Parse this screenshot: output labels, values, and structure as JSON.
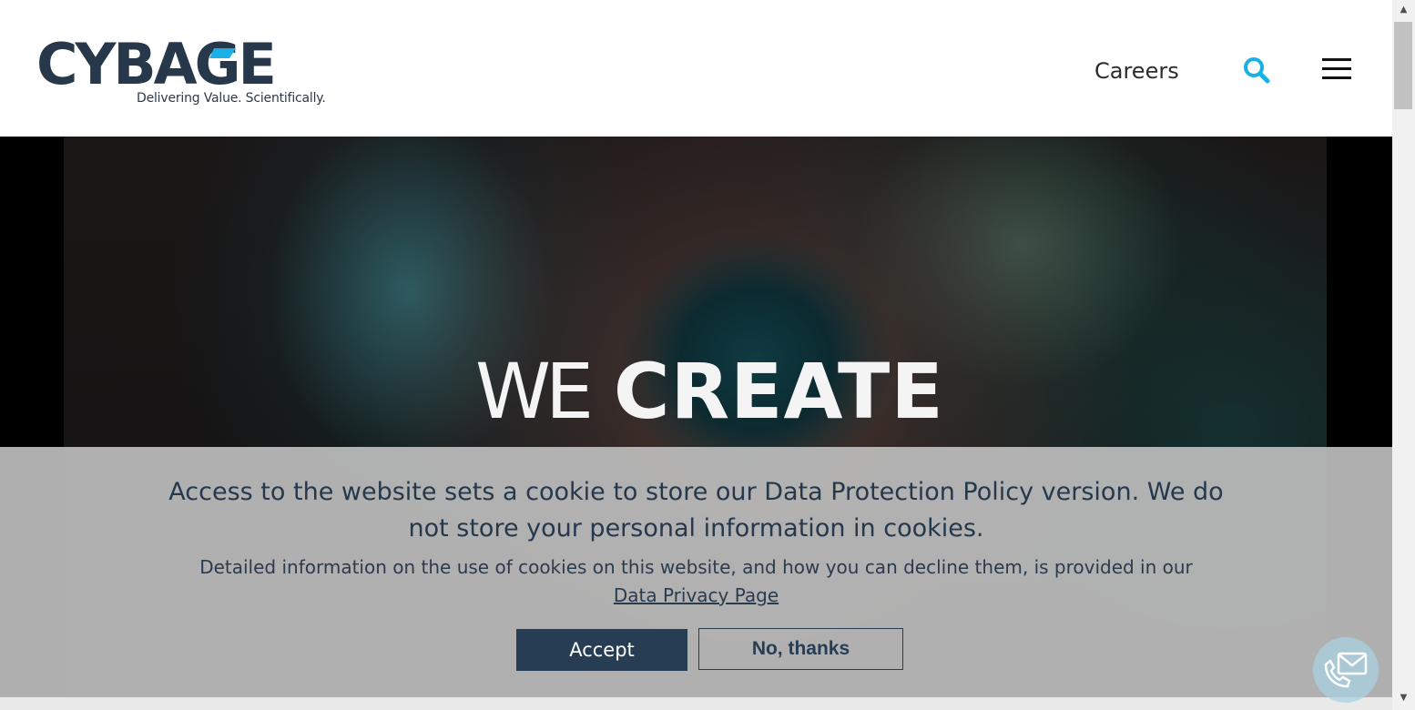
{
  "header": {
    "logo_text": "CYBAGE",
    "tagline": "Delivering Value. Scientifically.",
    "nav_careers": "Careers",
    "search_icon": "search-icon",
    "menu_icon": "hamburger-menu-icon",
    "accent_color": "#1ab0e6"
  },
  "hero": {
    "headline_light": "WE",
    "headline_bold": "CREATE"
  },
  "cookie_banner": {
    "heading": "Access to the website sets a cookie to store our Data Protection Policy version. We do not store your personal information in cookies.",
    "detail": "Detailed information on the use of cookies on this website, and how you can decline them, is provided in our",
    "link_label": "Data Privacy Page",
    "accept_label": "Accept",
    "decline_label": "No, thanks",
    "text_color": "#25384c",
    "button_color": "#263d54"
  },
  "contact_fab": {
    "icon": "contact-phone-mail-icon"
  },
  "scrollbar": {
    "up_arrow": "▲",
    "down_arrow": "▼"
  }
}
